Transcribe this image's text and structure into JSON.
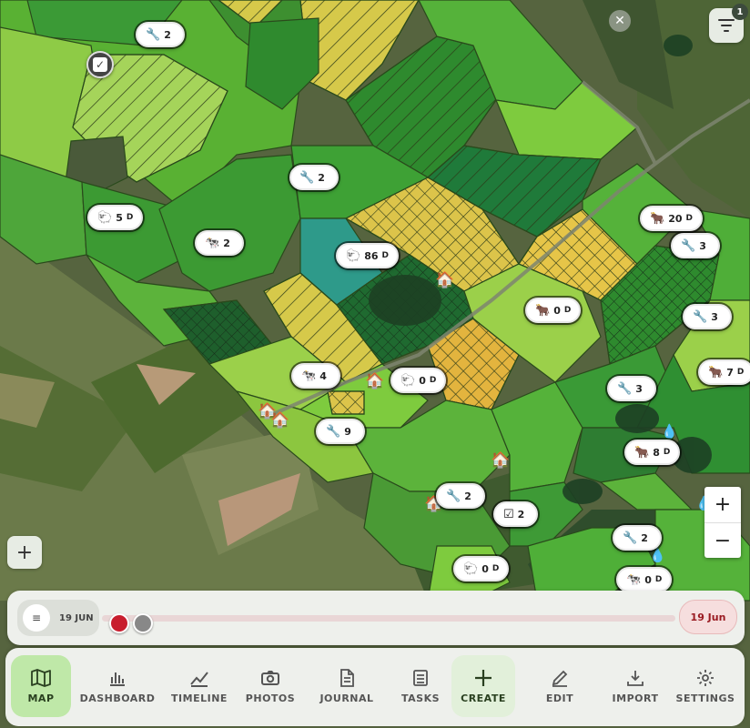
{
  "map": {
    "markers": [
      {
        "id": "m1",
        "icon": "wrench",
        "glyph": "🔧",
        "text": "2",
        "unit": ""
      },
      {
        "id": "m2",
        "icon": "wrench",
        "glyph": "🔧",
        "text": "2",
        "unit": ""
      },
      {
        "id": "m3",
        "icon": "sheep",
        "glyph": "🐑",
        "text": "5",
        "unit": "D"
      },
      {
        "id": "m4",
        "icon": "cow",
        "glyph": "🐄",
        "text": "2",
        "unit": ""
      },
      {
        "id": "m5",
        "icon": "sheep",
        "glyph": "🐑",
        "text": "86",
        "unit": "D"
      },
      {
        "id": "m6",
        "icon": "cattle",
        "glyph": "🐂",
        "text": "20",
        "unit": "D"
      },
      {
        "id": "m7",
        "icon": "wrench",
        "glyph": "🔧",
        "text": "3",
        "unit": ""
      },
      {
        "id": "m8",
        "icon": "cattle",
        "glyph": "🐂",
        "text": "0",
        "unit": "D"
      },
      {
        "id": "m9",
        "icon": "wrench",
        "glyph": "🔧",
        "text": "3",
        "unit": ""
      },
      {
        "id": "m10",
        "icon": "cow",
        "glyph": "🐄",
        "text": "4",
        "unit": ""
      },
      {
        "id": "m11",
        "icon": "sheep",
        "glyph": "🐑",
        "text": "0",
        "unit": "D"
      },
      {
        "id": "m12",
        "icon": "cattle",
        "glyph": "🐂",
        "text": "7",
        "unit": "D"
      },
      {
        "id": "m13",
        "icon": "wrench",
        "glyph": "🔧",
        "text": "3",
        "unit": ""
      },
      {
        "id": "m14",
        "icon": "wrench",
        "glyph": "🔧",
        "text": "9",
        "unit": ""
      },
      {
        "id": "m15",
        "icon": "cattle",
        "glyph": "🐂",
        "text": "8",
        "unit": "D"
      },
      {
        "id": "m16",
        "icon": "wrench",
        "glyph": "🔧",
        "text": "2",
        "unit": ""
      },
      {
        "id": "m17",
        "icon": "task-check",
        "glyph": "☑",
        "text": "2",
        "unit": ""
      },
      {
        "id": "m18",
        "icon": "wrench",
        "glyph": "🔧",
        "text": "2",
        "unit": ""
      },
      {
        "id": "m19",
        "icon": "sheep",
        "glyph": "🐑",
        "text": "0",
        "unit": "D"
      },
      {
        "id": "m20",
        "icon": "cow",
        "glyph": "🐄",
        "text": "0",
        "unit": "D"
      }
    ],
    "houses_glyph": "🏠",
    "drop_glyph": "💧",
    "close_glyph": "✕",
    "filter_count": "1",
    "zoom_in": "+",
    "zoom_out": "−",
    "add_glyph": "+",
    "check_glyph": "✓"
  },
  "timeline": {
    "menu_glyph": "≡",
    "start_date": "19 JUN",
    "end_date": "19 Jun"
  },
  "nav": {
    "items": [
      {
        "label": "MAP",
        "icon": "map-icon"
      },
      {
        "label": "DASHBOARD",
        "icon": "bar-chart-icon"
      },
      {
        "label": "TIMELINE",
        "icon": "trend-line-icon"
      },
      {
        "label": "PHOTOS",
        "icon": "camera-icon"
      },
      {
        "label": "JOURNAL",
        "icon": "document-icon"
      },
      {
        "label": "TASKS",
        "icon": "checklist-icon"
      },
      {
        "label": "CREATE",
        "icon": "plus-icon"
      },
      {
        "label": "EDIT",
        "icon": "pencil-icon"
      },
      {
        "label": "IMPORT",
        "icon": "download-icon"
      },
      {
        "label": "SETTINGS",
        "icon": "gear-icon"
      }
    ],
    "active": "MAP"
  },
  "colors": {
    "accent": "#bfe8a8",
    "timeline_handle": "#c81e2e",
    "paddock_bright": "#5fb83a",
    "paddock_dark": "#2e7d32",
    "paddock_yellow": "#cfc24a",
    "paddock_teal": "#2e9a8a"
  }
}
